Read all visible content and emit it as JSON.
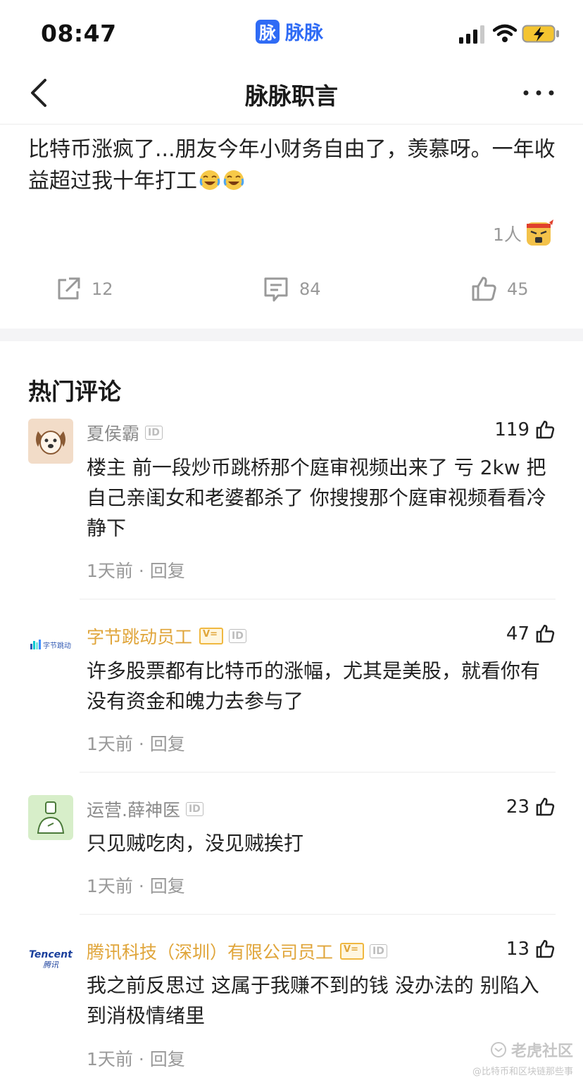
{
  "status_bar": {
    "time": "08:47",
    "app_logo_char": "脉",
    "app_name": "脉脉"
  },
  "nav": {
    "title": "脉脉职言"
  },
  "post": {
    "text": "比特币涨疯了...朋友今年小财务自由了，羡慕呀。一年收益超过我十年打工",
    "reaction_count": "1人",
    "share_count": "12",
    "comment_count": "84",
    "like_count": "45"
  },
  "comments_section": {
    "title": "热门评论"
  },
  "comments": [
    {
      "name": "夏侯霸",
      "verified": false,
      "likes": "119",
      "text": "楼主 前一段炒币跳桥那个庭审视频出来了 亏 2kw 把自己亲闺女和老婆都杀了 你搜搜那个庭审视频看看冷静下",
      "time": "1天前",
      "reply": "回复",
      "avatar": "dog-avatar"
    },
    {
      "name": "字节跳动员工",
      "verified": true,
      "likes": "47",
      "text": "许多股票都有比特币的涨幅，尤其是美股，就看你有没有资金和魄力去参与了",
      "time": "1天前",
      "reply": "回复",
      "avatar": "bytedance-logo",
      "logo_text": "字节跳动"
    },
    {
      "name": "运营.薛神医",
      "verified": false,
      "likes": "23",
      "text": "只见贼吃肉，没见贼挨打",
      "time": "1天前",
      "reply": "回复",
      "avatar": "person-avatar"
    },
    {
      "name": "腾讯科技（深圳）有限公司员工",
      "verified": true,
      "likes": "13",
      "text": "我之前反思过 这属于我赚不到的钱 没办法的 别陷入到消极情绪里",
      "time": "1天前",
      "reply": "回复",
      "avatar": "tencent-logo",
      "logo_text": "Tencent",
      "logo_sub": "腾讯"
    }
  ],
  "tags": {
    "id": "ID",
    "v": "V="
  },
  "meta_separator": "·",
  "watermark": {
    "line1": "老虎社区",
    "line2": "@比特币和区块链那些事"
  },
  "colors": {
    "accent": "#2f6bf5",
    "company": "#e0a53a",
    "muted": "#999999"
  }
}
